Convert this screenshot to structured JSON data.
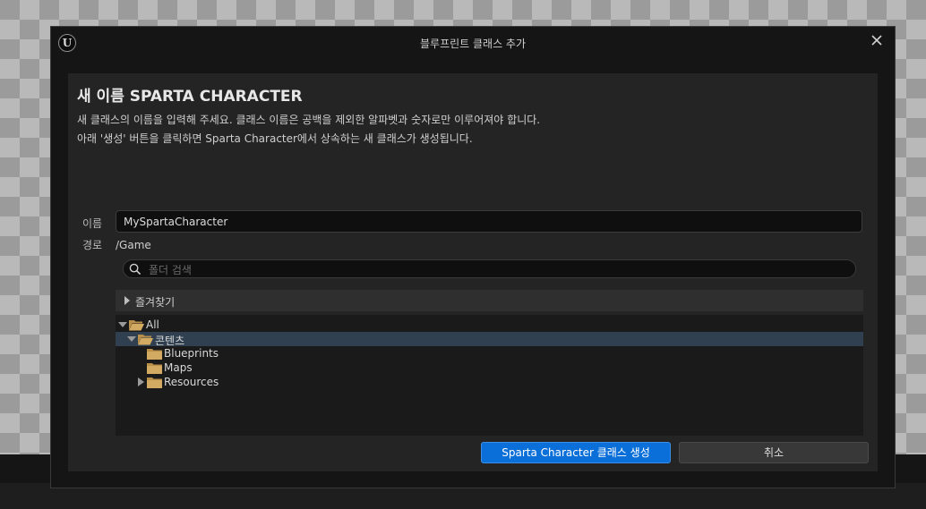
{
  "window": {
    "title": "블루프린트 클래스 추가",
    "logo_text": "U"
  },
  "panel": {
    "heading": "새 이름 SPARTA CHARACTER",
    "description_line1": "새 클래스의 이름을 입력해 주세요. 클래스 이름은 공백을 제외한 알파벳과 숫자로만 이루어져야 합니다.",
    "description_line2": "아래 '생성' 버튼을 클릭하면 Sparta Character에서 상속하는 새 클래스가 생성됩니다."
  },
  "form": {
    "name_label": "이름",
    "name_value": "MySpartaCharacter",
    "path_label": "경로",
    "path_value": "/Game"
  },
  "search": {
    "placeholder": "폴더 검색",
    "icon": "search-icon"
  },
  "favorites": {
    "label": "즐겨찾기",
    "expanded": false
  },
  "tree": {
    "items": [
      {
        "label": "All",
        "depth": 0,
        "expanded": true,
        "has_children": true,
        "selected": false
      },
      {
        "label": "콘텐츠",
        "depth": 1,
        "expanded": true,
        "has_children": true,
        "selected": true
      },
      {
        "label": "Blueprints",
        "depth": 2,
        "expanded": false,
        "has_children": false,
        "selected": false
      },
      {
        "label": "Maps",
        "depth": 2,
        "expanded": false,
        "has_children": false,
        "selected": false
      },
      {
        "label": "Resources",
        "depth": 2,
        "expanded": false,
        "has_children": true,
        "selected": false
      }
    ]
  },
  "buttons": {
    "create_label": "Sparta Character 클래스 생성",
    "cancel_label": "취소"
  },
  "colors": {
    "accent": "#0a6fd8",
    "selection": "#304050",
    "folder": "#c9a15a",
    "panel": "#242424"
  }
}
